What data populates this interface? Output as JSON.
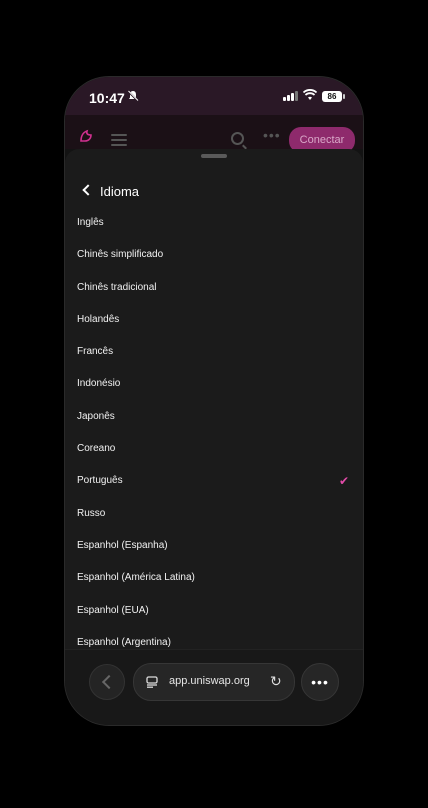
{
  "status_bar": {
    "time": "10:47",
    "battery": "86"
  },
  "app_bar": {
    "connect_label": "Conectar"
  },
  "sheet": {
    "title": "Idioma",
    "selected_index": 8,
    "languages": [
      "Inglês",
      "Chinês simplificado",
      "Chinês tradicional",
      "Holandês",
      "Francês",
      "Indonésio",
      "Japonês",
      "Coreano",
      "Português",
      "Russo",
      "Espanhol (Espanha)",
      "Espanhol (América Latina)",
      "Espanhol (EUA)",
      "Espanhol (Argentina)"
    ]
  },
  "browser": {
    "url": "app.uniswap.org"
  },
  "colors": {
    "accent": "#e14ba8",
    "connect_bg": "#8e2a6c"
  }
}
